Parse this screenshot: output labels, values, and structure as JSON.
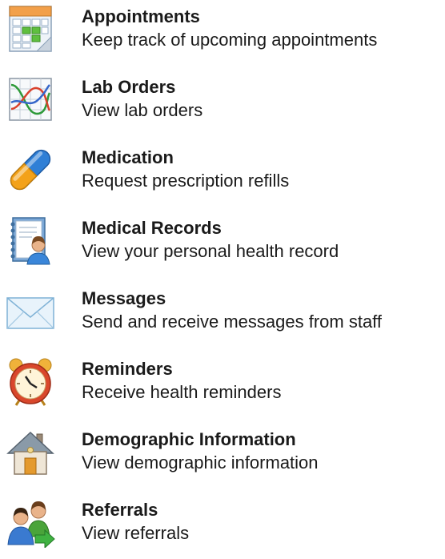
{
  "menu": {
    "items": [
      {
        "title": "Appointments",
        "description": "Keep track of upcoming appointments",
        "icon": "calendar-icon"
      },
      {
        "title": "Lab Orders",
        "description": "View lab orders",
        "icon": "chart-icon"
      },
      {
        "title": "Medication",
        "description": "Request prescription refills",
        "icon": "pill-icon"
      },
      {
        "title": "Medical Records",
        "description": "View your personal health record",
        "icon": "medical-record-icon"
      },
      {
        "title": "Messages",
        "description": "Send and receive messages from staff",
        "icon": "envelope-icon"
      },
      {
        "title": "Reminders",
        "description": "Receive health reminders",
        "icon": "alarm-clock-icon"
      },
      {
        "title": "Demographic Information",
        "description": "View demographic information",
        "icon": "house-icon"
      },
      {
        "title": "Referrals",
        "description": "View referrals",
        "icon": "users-arrow-icon"
      }
    ]
  }
}
